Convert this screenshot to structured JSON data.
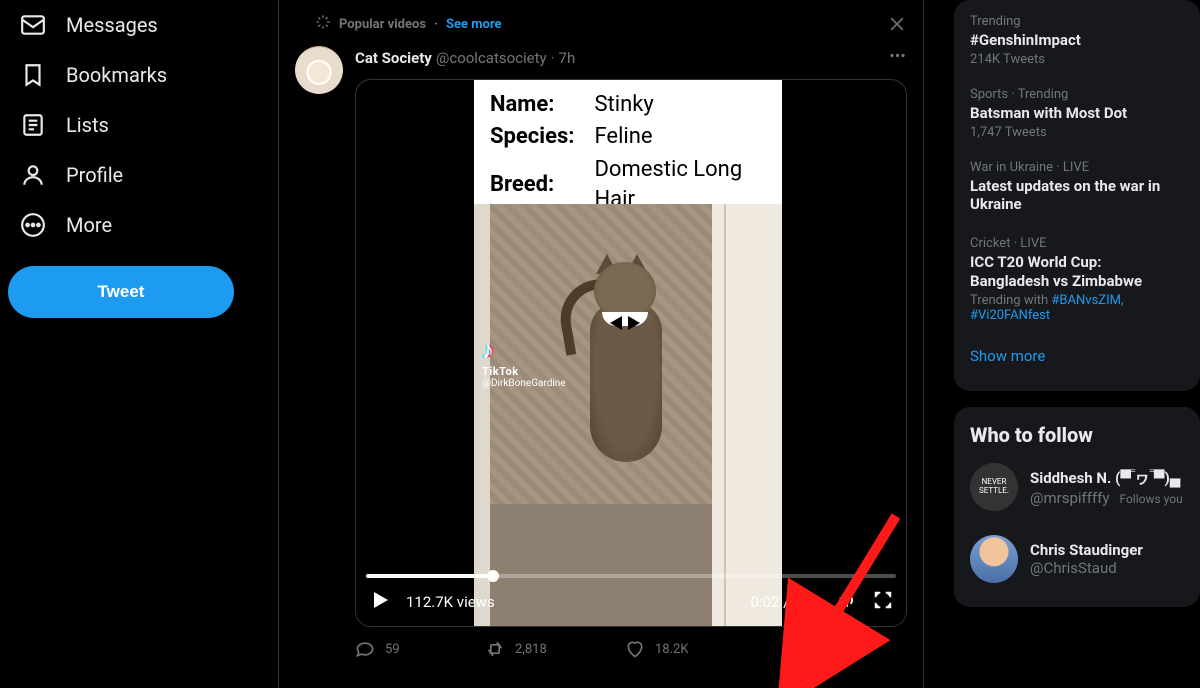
{
  "sidebar": {
    "items": [
      {
        "label": "Messages",
        "icon": "mail-icon"
      },
      {
        "label": "Bookmarks",
        "icon": "bookmark-icon"
      },
      {
        "label": "Lists",
        "icon": "list-icon"
      },
      {
        "label": "Profile",
        "icon": "profile-icon"
      },
      {
        "label": "More",
        "icon": "more-circle-icon"
      }
    ],
    "tweet_button": "Tweet"
  },
  "promo": {
    "label": "Popular videos",
    "see_more": "See more"
  },
  "tweet": {
    "name": "Cat Society",
    "handle": "@coolcatsociety",
    "time": "7h",
    "video_info": {
      "name_label": "Name:",
      "name_value": "Stinky",
      "species_label": "Species:",
      "species_value": "Feline",
      "breed_label": "Breed:",
      "breed_value": "Domestic Long Hair"
    },
    "tiktok": {
      "brand": "TikTok",
      "user": "@DirkBoneGardine"
    },
    "controls": {
      "views": "112.7K views",
      "time": "0:02 / 0:10"
    },
    "actions": {
      "replies": "59",
      "retweets": "2,818",
      "likes": "18.2K"
    }
  },
  "trends_panel": {
    "items": [
      {
        "meta": "Trending",
        "title": "#GenshinImpact",
        "sub": "214K Tweets"
      },
      {
        "meta": "Sports · Trending",
        "title": "Batsman with Most Dot",
        "sub": "1,747 Tweets"
      },
      {
        "meta": "War in Ukraine · LIVE",
        "title": "Latest updates on the war in Ukraine",
        "sub": ""
      },
      {
        "meta": "Cricket · LIVE",
        "title": "ICC T20 World Cup: Bangladesh vs Zimbabwe",
        "sub": "",
        "trending_with_label": "Trending with",
        "hashtags": "#BANvsZIM, #Vi20FANfest"
      }
    ],
    "show_more": "Show more"
  },
  "who_to_follow": {
    "heading": "Who to follow",
    "items": [
      {
        "name": "Siddhesh N. (▀̿ ヮ ̿▀)▄",
        "handle": "@mrspiffffy",
        "follows": "Follows you",
        "avatar_text": "NEVER SETTLE."
      },
      {
        "name": "Chris Staudinger",
        "handle": "@ChrisStaud"
      }
    ]
  }
}
